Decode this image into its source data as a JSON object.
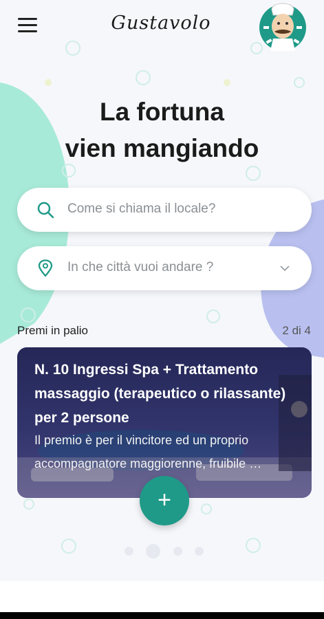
{
  "header": {
    "menu_icon": "hamburger-menu-icon",
    "logo_text": "Gustavolo",
    "avatar_icon": "chef-avatar-icon"
  },
  "hero": {
    "line1": "La fortuna",
    "line2": "vien mangiando"
  },
  "search": {
    "icon": "search-icon",
    "placeholder": "Come si chiama il locale?"
  },
  "city": {
    "icon": "location-pin-icon",
    "placeholder": "In che città vuoi andare ?",
    "chevron": "chevron-down-icon"
  },
  "prizes": {
    "label": "Premi in palio",
    "pager": "2 di 4",
    "card": {
      "title": "N. 10 Ingressi Spa + Trattamento massaggio (terapeutico o rilassante) per 2 persone",
      "description_line1": "Il premio è per il vincitore ed un proprio",
      "description_line2": "accompagnatore maggiorenne, fruibile …"
    },
    "add_icon": "plus-icon",
    "add_label": "+",
    "total_slides": 4,
    "active_slide": 2
  },
  "colors": {
    "accent": "#1f9a88",
    "mint_blob": "#a8ead8",
    "lavender_blob": "#b9c0f0"
  }
}
